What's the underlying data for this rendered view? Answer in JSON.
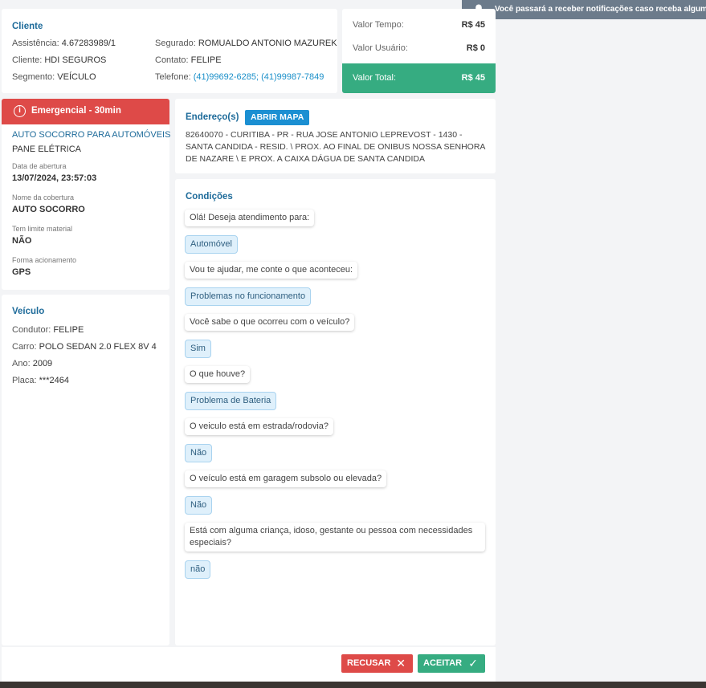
{
  "notification": {
    "text": "Você passará a receber notificações caso receba algum servi"
  },
  "cliente": {
    "title": "Cliente",
    "assistencia_label": "Assistência:",
    "assistencia_value": "4.67283989/1",
    "cliente_label": "Cliente:",
    "cliente_value": "HDI SEGUROS",
    "segmento_label": "Segmento:",
    "segmento_value": "VEÍCULO",
    "segurado_label": "Segurado:",
    "segurado_value": "ROMUALDO ANTONIO MAZUREK",
    "contato_label": "Contato:",
    "contato_value": "FELIPE",
    "telefone_label": "Telefone:",
    "telefone_value": "(41)99692-6285; (41)99987-7849"
  },
  "valores": {
    "tempo_label": "Valor Tempo:",
    "tempo_value": "R$ 45",
    "usuario_label": "Valor Usuário:",
    "usuario_value": "R$ 0",
    "total_label": "Valor Total:",
    "total_value": "R$ 45"
  },
  "atendimento": {
    "urgency": "Emergencial - 30min",
    "service": "AUTO SOCORRO PARA AUTOMÓVEIS",
    "problem": "PANE ELÉTRICA",
    "data_label": "Data de abertura",
    "data_value": "13/07/2024, 23:57:03",
    "cobertura_label": "Nome da cobertura",
    "cobertura_value": "AUTO SOCORRO",
    "limite_label": "Tem limite material",
    "limite_value": "NÃO",
    "forma_label": "Forma acionamento",
    "forma_value": "GPS"
  },
  "veiculo": {
    "title": "Veículo",
    "condutor_label": "Condutor:",
    "condutor_value": "FELIPE",
    "carro_label": "Carro:",
    "carro_value": "POLO SEDAN 2.0 FLEX 8V 4",
    "ano_label": "Ano:",
    "ano_value": "2009",
    "placa_label": "Placa:",
    "placa_value": "***2464"
  },
  "endereco": {
    "title": "Endereço(s)",
    "map_button": "ABRIR MAPA",
    "text": "82640070 - CURITIBA - PR - RUA JOSE ANTONIO LEPREVOST - 1430 - SANTA CANDIDA - RESID. \\ PROX. AO FINAL DE ONIBUS NOSSA SENHORA DE NAZARE \\ E PROX. A CAIXA DÁGUA DE SANTA CANDIDA"
  },
  "condicoes": {
    "title": "Condições",
    "messages": [
      "Olá! Deseja atendimento para:",
      "Automóvel",
      "Vou te ajudar, me conte o que aconteceu:",
      "Problemas no funcionamento",
      "Você sabe o que ocorreu com o veículo?",
      "Sim",
      "O que houve?",
      "Problema de Bateria",
      "O veiculo está em estrada/rodovia?",
      "Não",
      "O veículo está em garagem subsolo ou elevada?",
      "Não",
      "Está com alguma criança, idoso, gestante ou pessoa com necessidades especiais?",
      "não"
    ]
  },
  "actions": {
    "reject": "RECUSAR",
    "accept": "ACEITAR"
  },
  "colors": {
    "accent_blue": "#1e6b9a",
    "danger": "#de4a48",
    "success": "#36ac81"
  }
}
